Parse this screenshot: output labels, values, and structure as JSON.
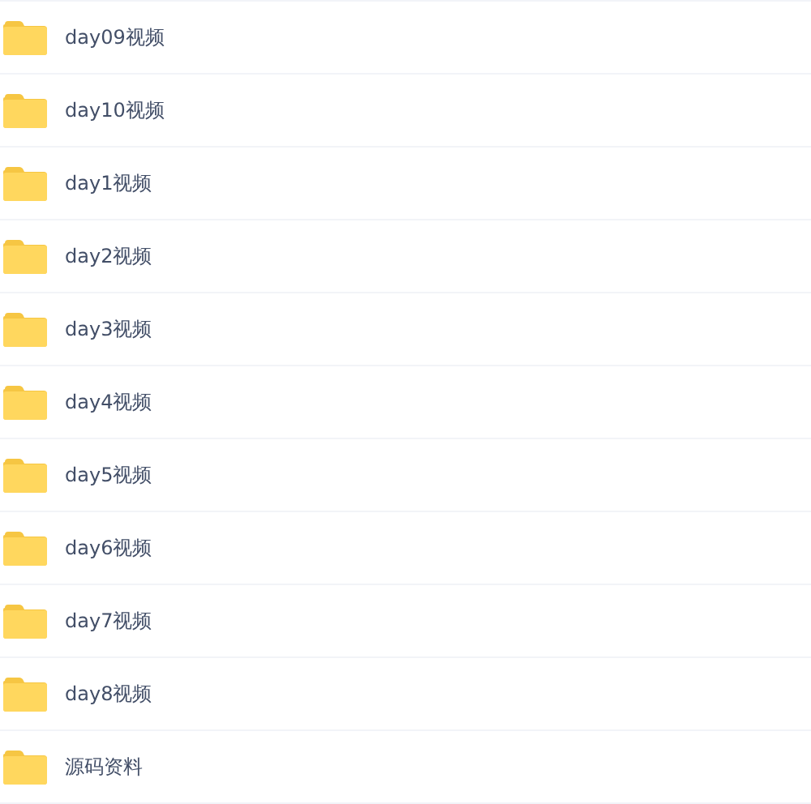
{
  "files": [
    {
      "name": "day09视频"
    },
    {
      "name": "day10视频"
    },
    {
      "name": "day1视频"
    },
    {
      "name": "day2视频"
    },
    {
      "name": "day3视频"
    },
    {
      "name": "day4视频"
    },
    {
      "name": "day5视频"
    },
    {
      "name": "day6视频"
    },
    {
      "name": "day7视频"
    },
    {
      "name": "day8视频"
    },
    {
      "name": "源码资料"
    }
  ]
}
